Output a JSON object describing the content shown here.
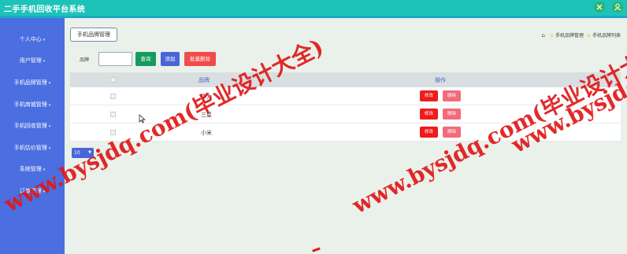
{
  "app": {
    "title": "二手手机回收平台系统"
  },
  "sidebar": {
    "items": [
      {
        "label": "个人中心"
      },
      {
        "label": "用户管理"
      },
      {
        "label": "手机品牌管理"
      },
      {
        "label": "手机商城管理"
      },
      {
        "label": "手机回收管理"
      },
      {
        "label": "手机估价管理"
      },
      {
        "label": "系统管理"
      },
      {
        "label": "订单管理"
      }
    ]
  },
  "page": {
    "tab_label": "手机品牌管理",
    "breadcrumb": {
      "level1": "手机品牌管理",
      "level2": "手机品牌列表"
    }
  },
  "search": {
    "label": "品牌",
    "input_value": "",
    "query_label": "查询",
    "add_label": "添加",
    "batch_delete_label": "批量删除"
  },
  "table": {
    "columns": {
      "name": "品牌",
      "op": "操作"
    },
    "rows": [
      {
        "name": "华为",
        "edit": "修改",
        "delete": "删除"
      },
      {
        "name": "三星",
        "edit": "修改",
        "delete": "删除"
      },
      {
        "name": "小米",
        "edit": "修改",
        "delete": "删除"
      }
    ]
  },
  "pagination": {
    "page_size": "10"
  },
  "watermark": {
    "text1": "www.bysjdq.com(毕业设计大全)",
    "text2": "www.bysjdq.com(毕业设计大全)",
    "text3": "www.bysjdq.com(毕业设计大全)"
  },
  "colors": {
    "topbar": "#1dc3b8",
    "sidebar": "#4b6ee0",
    "background": "#eaf1ea",
    "edit_button": "#f01c1c",
    "delete_button": "#f36a7a",
    "watermark": "#e01818"
  }
}
